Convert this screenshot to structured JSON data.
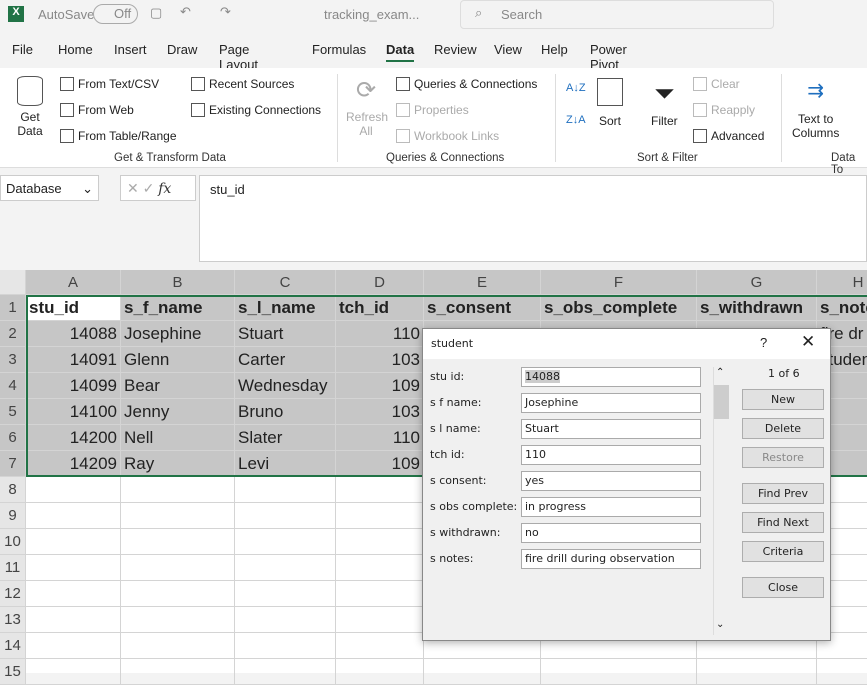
{
  "titlebar": {
    "autosave_label": "AutoSave",
    "autosave_state": "Off",
    "filename": "tracking_exam...",
    "search_placeholder": "Search"
  },
  "tabs": [
    "File",
    "Home",
    "Insert",
    "Draw",
    "Page Layout",
    "Formulas",
    "Data",
    "Review",
    "View",
    "Help",
    "Power Pivot"
  ],
  "active_tab": "Data",
  "ribbon": {
    "get_data": "Get",
    "get_data2": "Data",
    "from_text": "From Text/CSV",
    "from_web": "From Web",
    "from_table": "From Table/Range",
    "recent": "Recent Sources",
    "existing": "Existing Connections",
    "group1": "Get & Transform Data",
    "refresh": "Refresh",
    "refresh2": "All",
    "queries": "Queries & Connections",
    "properties": "Properties",
    "links": "Workbook Links",
    "group2": "Queries & Connections",
    "sort": "Sort",
    "filter": "Filter",
    "clear": "Clear",
    "reapply": "Reapply",
    "advanced": "Advanced",
    "group3": "Sort & Filter",
    "text_to": "Text to",
    "columns": "Columns",
    "group4": "Data To"
  },
  "formula_bar": {
    "name_box": "Database",
    "fx": "fx",
    "value": "stu_id"
  },
  "columns": [
    "A",
    "B",
    "C",
    "D",
    "E",
    "F",
    "G",
    "H"
  ],
  "rows": [
    "1",
    "2",
    "3",
    "4",
    "5",
    "6",
    "7",
    "8",
    "9",
    "10",
    "11",
    "12",
    "13",
    "14",
    "15"
  ],
  "sheet": [
    [
      "stu_id",
      "s_f_name",
      "s_l_name",
      "tch_id",
      "s_consent",
      "s_obs_complete",
      "s_withdrawn",
      "s_notes"
    ],
    [
      "14088",
      "Josephine",
      "Stuart",
      "110",
      "",
      "",
      "",
      "fire dr"
    ],
    [
      "14091",
      "Glenn",
      "Carter",
      "103",
      "",
      "",
      "",
      "studen"
    ],
    [
      "14099",
      "Bear",
      "Wednesday",
      "109",
      "",
      "",
      "",
      ""
    ],
    [
      "14100",
      "Jenny",
      "Bruno",
      "103",
      "",
      "",
      "",
      ""
    ],
    [
      "14200",
      "Nell",
      "Slater",
      "110",
      "",
      "",
      "",
      ""
    ],
    [
      "14209",
      "Ray",
      "Levi",
      "109",
      "",
      "",
      "",
      ""
    ]
  ],
  "dialog": {
    "title": "student",
    "help": "?",
    "record": "1 of 6",
    "fields": [
      {
        "label": "stu id:",
        "value": "14088"
      },
      {
        "label": "s f name:",
        "value": "Josephine"
      },
      {
        "label": "s l name:",
        "value": "Stuart"
      },
      {
        "label": "tch id:",
        "value": "110"
      },
      {
        "label": "s consent:",
        "value": "yes"
      },
      {
        "label": "s obs complete:",
        "value": "in progress"
      },
      {
        "label": "s withdrawn:",
        "value": "no"
      },
      {
        "label": "s notes:",
        "value": "fire drill during observation"
      }
    ],
    "buttons": {
      "new": "New",
      "delete": "Delete",
      "restore": "Restore",
      "find_prev": "Find Prev",
      "find_next": "Find Next",
      "criteria": "Criteria",
      "close": "Close"
    }
  },
  "colors": {
    "excel_green": "#217346",
    "selection": "#c6c6c6"
  }
}
